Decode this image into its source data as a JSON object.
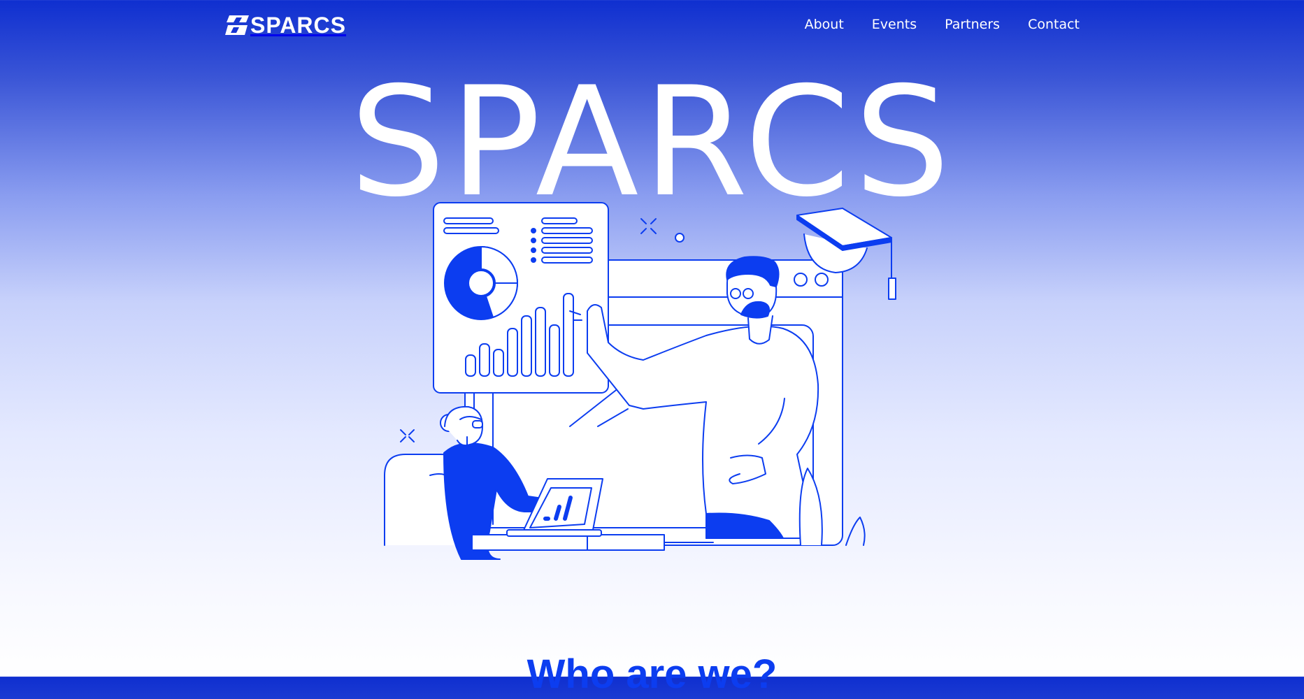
{
  "header": {
    "logo_text": "SPARCS",
    "nav": [
      {
        "label": "About"
      },
      {
        "label": "Events"
      },
      {
        "label": "Partners"
      },
      {
        "label": "Contact"
      }
    ]
  },
  "hero": {
    "title": "SPARCS",
    "illustration": "presentation-graduation-illustration"
  },
  "about": {
    "heading": "Who are we?"
  },
  "colors": {
    "accent": "#0c3df0",
    "header_top": "#0f2fd0",
    "white": "#ffffff"
  }
}
